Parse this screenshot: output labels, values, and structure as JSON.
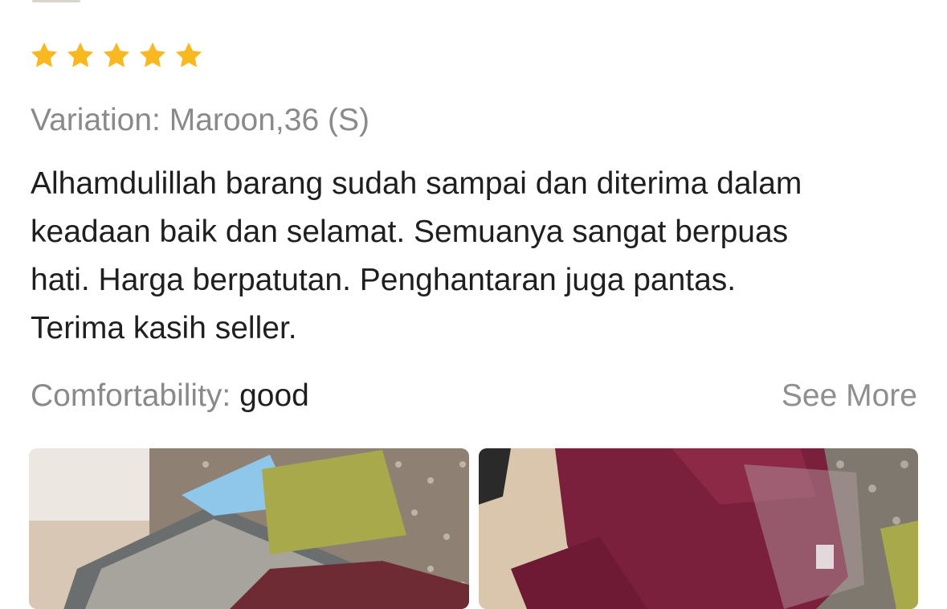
{
  "review": {
    "rating": 5,
    "rating_max": 5,
    "star_color": "#F8B920",
    "variation_text": "Variation: Maroon,36 (S)",
    "body_lines": [
      "Alhamdulillah barang sudah sampai dan diterima dalam",
      "keadaan baik dan selamat. Semuanya sangat berpuas",
      "hati. Harga berpatutan. Penghantaran juga pantas.",
      "Terima kasih seller."
    ],
    "attribute": {
      "label": "Comfortability: ",
      "value": "good"
    },
    "see_more_label": "See More",
    "photos": [
      {
        "icon": "review-photo-pillows-on-carpet"
      },
      {
        "icon": "review-photo-maroon-garment"
      }
    ]
  }
}
